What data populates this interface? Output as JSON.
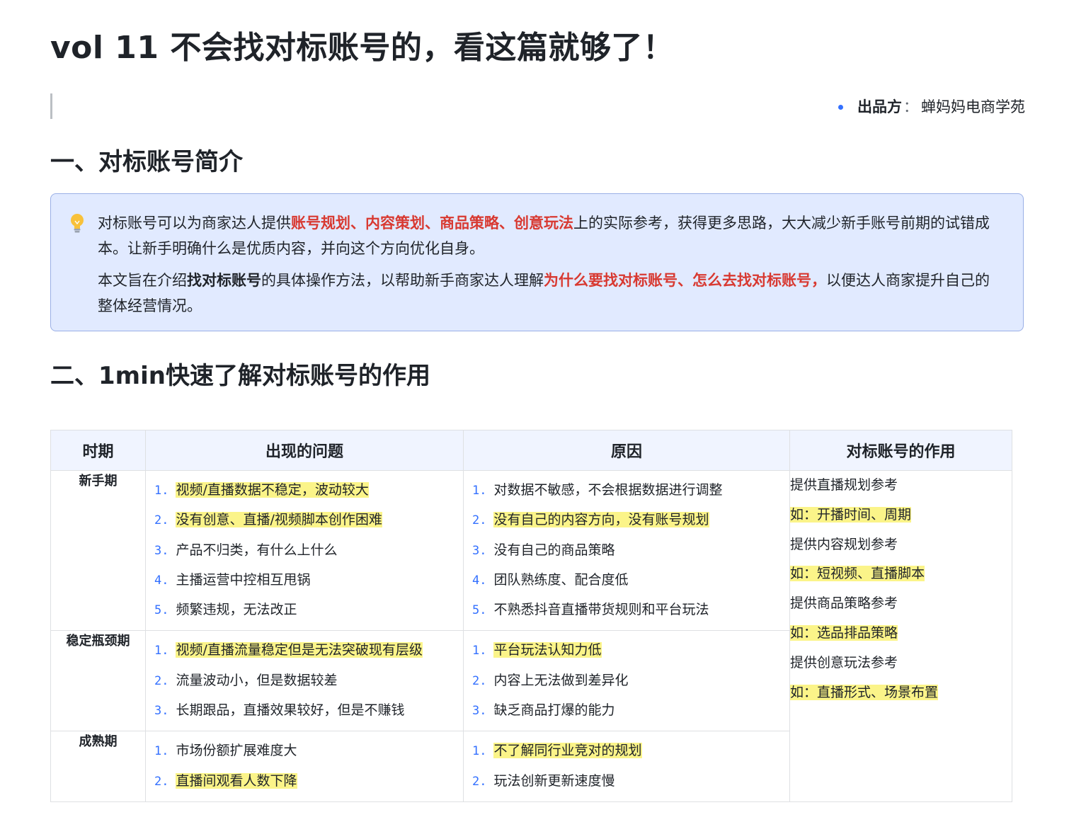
{
  "title": "vol 11 不会找对标账号的，看这篇就够了！",
  "meta": {
    "label": "出品方",
    "separator": "：",
    "value": "蝉妈妈电商学苑"
  },
  "section1": {
    "heading": "一、对标账号简介"
  },
  "callout": {
    "icon": "lightbulb-icon",
    "p1": {
      "t1": "对标账号可以为商家达人提供",
      "red1": "账号规划、内容策划、商品策略、创意玩法",
      "t2": "上的实际参考，获得更多思路，大大减少新手账号前期的试错成本。让新手明确什么是优质内容，并向这个方向优化自身。"
    },
    "p2": {
      "t1": "本文旨在介绍",
      "bold1": "找对标账号",
      "t2": "的具体操作方法，以帮助新手商家达人理解",
      "red1": "为什么要找对标账号、怎么去找对标账号，",
      "t3": "以便达人商家提升自己的整体经营情况。"
    }
  },
  "section2": {
    "heading": "二、1min快速了解对标账号的作用"
  },
  "table": {
    "headers": [
      "时期",
      "出现的问题",
      "原因",
      "对标账号的作用"
    ],
    "rows": [
      {
        "period": "新手期",
        "problems": [
          {
            "num": "1.",
            "text": "视频/直播数据不稳定，波动较大",
            "hl": true
          },
          {
            "num": "2.",
            "text": "没有创意、直播/视频脚本创作困难",
            "hl": true
          },
          {
            "num": "3.",
            "text": "产品不归类，有什么上什么",
            "hl": false
          },
          {
            "num": "4.",
            "text": "主播运营中控相互甩锅",
            "hl": false
          },
          {
            "num": "5.",
            "text": "频繁违规，无法改正",
            "hl": false
          }
        ],
        "reasons": [
          {
            "num": "1.",
            "text": "对数据不敏感，不会根据数据进行调整",
            "hl": false
          },
          {
            "num": "2.",
            "text": "没有自己的内容方向，没有账号规划",
            "hl": true
          },
          {
            "num": "3.",
            "text": "没有自己的商品策略",
            "hl": false
          },
          {
            "num": "4.",
            "text": "团队熟练度、配合度低",
            "hl": false
          },
          {
            "num": "5.",
            "text": "不熟悉抖音直播带货规则和平台玩法",
            "hl": false
          }
        ]
      },
      {
        "period": "稳定瓶颈期",
        "problems": [
          {
            "num": "1.",
            "text": "视频/直播流量稳定但是无法突破现有层级",
            "hl": true
          },
          {
            "num": "2.",
            "text": "流量波动小，但是数据较差",
            "hl": false
          },
          {
            "num": "3.",
            "text": "长期跟品，直播效果较好，但是不赚钱",
            "hl": false
          }
        ],
        "reasons": [
          {
            "num": "1.",
            "text": "平台玩法认知力低",
            "hl": true
          },
          {
            "num": "2.",
            "text": "内容上无法做到差异化",
            "hl": false
          },
          {
            "num": "3.",
            "text": "缺乏商品打爆的能力",
            "hl": false
          }
        ]
      },
      {
        "period": "成熟期",
        "problems": [
          {
            "num": "1.",
            "text": "市场份额扩展难度大",
            "hl": false
          },
          {
            "num": "2.",
            "text": "直播间观看人数下降",
            "hl": true
          }
        ],
        "reasons": [
          {
            "num": "1.",
            "text": "不了解同行业竞对的规划",
            "hl": true
          },
          {
            "num": "2.",
            "text": "玩法创新更新速度慢",
            "hl": false
          }
        ]
      }
    ],
    "effects": [
      {
        "text": "提供直播规划参考",
        "hl": false
      },
      {
        "text": "如：开播时间、周期",
        "hl": true
      },
      {
        "text": "提供内容规划参考",
        "hl": false
      },
      {
        "text": "如：短视频、直播脚本",
        "hl": true
      },
      {
        "text": "提供商品策略参考",
        "hl": false
      },
      {
        "text": "如：选品排品策略",
        "hl": true
      },
      {
        "text": "提供创意玩法参考",
        "hl": false
      },
      {
        "text": "如：直播形式、场景布置",
        "hl": true
      }
    ]
  },
  "colors": {
    "accent": "#3370ff",
    "red": "#d83931",
    "highlight": "#fbf489",
    "callout_bg": "#e1eaff"
  }
}
